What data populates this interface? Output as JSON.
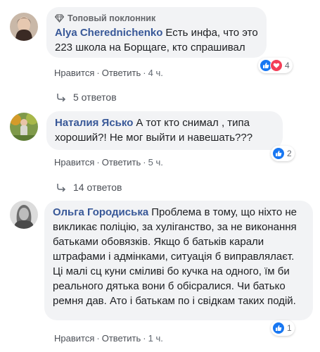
{
  "comments": [
    {
      "badge": "Топовый поклонник",
      "author": "Alya Cherednichenko",
      "text": "Есть инфа, что это 223 школа на Борщаге, кто спрашивал",
      "like": "Нравится",
      "reply": "Ответить",
      "time": "4 ч.",
      "reaction_count": "4"
    },
    {
      "author": "Наталия Ясько",
      "text": "А тот кто снимал , типа хороший?! Не мог выйти и навешать???",
      "like": "Нравится",
      "reply": "Ответить",
      "time": "5 ч.",
      "reaction_count": "2"
    },
    {
      "author": "Ольга Городиська",
      "text": "Проблема в тому, що ніхто не викликає поліцію, за хуліганство, за не виконання батьками обовязків. Якщо б батьків карали штрафами і адмінками, ситуація б виправлялаєт. Ці малі сц  куни сміливі бо кучка на одного, їм би реального дятька вони б обісралися. Чи батько ремня дав. Ато і батькам по   і свідкам таких подій.",
      "like": "Нравится",
      "reply": "Ответить",
      "time": "1 ч.",
      "reaction_count": "1"
    }
  ],
  "reply_threads": [
    {
      "label": "5 ответов"
    },
    {
      "label": "14 ответов"
    }
  ],
  "colors": {
    "author": "#385898",
    "bubble": "#f2f3f5",
    "like": "#1877f2",
    "love": "#f33e58"
  },
  "icons": [
    "diamond-icon",
    "like-icon",
    "love-icon",
    "reply-arrow-icon"
  ]
}
